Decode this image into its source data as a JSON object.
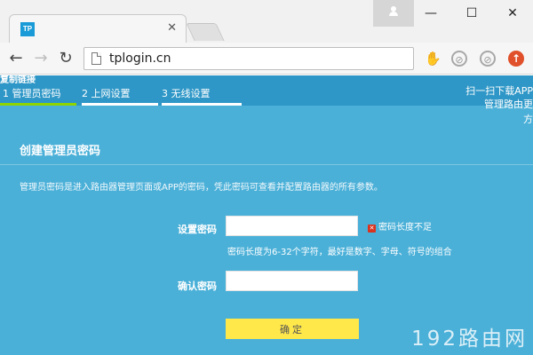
{
  "browser": {
    "tab": {
      "favicon_text": "TP",
      "close_glyph": "✕"
    },
    "window_controls": {
      "minimize": "—",
      "maximize": "☐",
      "close": "✕"
    },
    "nav": {
      "back": "←",
      "forward": "→",
      "reload": "↻"
    },
    "url": "tplogin.cn",
    "extensions": [
      "puzzle-icon",
      "no-icon",
      "no-icon",
      "arrow-up-icon"
    ]
  },
  "steps": {
    "overflow_text": "复制链接",
    "items": [
      {
        "label": "1 管理员密码"
      },
      {
        "label": "2 上网设置"
      },
      {
        "label": "3 无线设置"
      }
    ],
    "app_promo": {
      "line1": "扫一扫下载APP",
      "line2": "管理路由更",
      "line3": "方"
    }
  },
  "form": {
    "title": "创建管理员密码",
    "description": "管理员密码是进入路由器管理页面或APP的密码，凭此密码可查看并配置路由器的所有参数。",
    "password_label": "设置密码",
    "password_value": "",
    "error_text": "密码长度不足",
    "hint": "密码长度为6-32个字符，最好是数字、字母、符号的组合",
    "confirm_label": "确认密码",
    "confirm_value": "",
    "submit": "确定"
  },
  "watermark": "192路由网",
  "colors": {
    "page_bg": "#4bb0d8",
    "stepbar_bg": "#2f97c7",
    "active_step": "#8fd400",
    "button": "#ffe84a"
  }
}
